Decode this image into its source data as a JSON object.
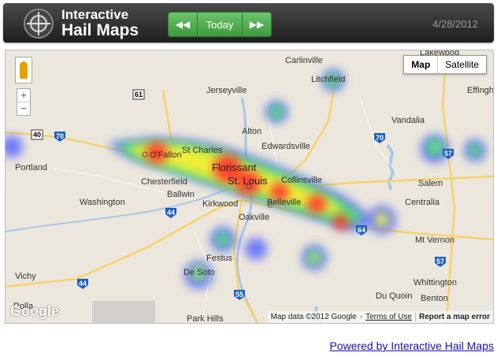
{
  "header": {
    "logo_line1": "Interactive",
    "logo_line2": "Hail Maps",
    "prev_icon": "double-left-arrow-icon",
    "next_icon": "double-right-arrow-icon",
    "today_label": "Today",
    "date": "4/28/2012"
  },
  "map": {
    "type_options": [
      "Map",
      "Satellite"
    ],
    "active_type": "Map",
    "zoom_in": "+",
    "zoom_out": "−",
    "google_logo": "Google",
    "attribution": "Map data ©2012 Google",
    "terms": "Terms of Use",
    "report": "Report a map error",
    "places": [
      "Carlinville",
      "Lakewood",
      "Litchfield",
      "Effingham",
      "Jerseyville",
      "Alton",
      "Vandalia",
      "Edwardsville",
      "O'Fallon",
      "St Charles",
      "Florissant",
      "Chesterfield",
      "St. Louis",
      "Collinsville",
      "Salem",
      "Ballwin",
      "Kirkwood",
      "Belleville",
      "Centralia",
      "Washington",
      "Portland",
      "Oakville",
      "Festus",
      "Mt Vernon",
      "De Soto",
      "Vichy",
      "Whittington",
      "Rolla",
      "Du Quoin",
      "Benton",
      "Park Hills"
    ],
    "route_shields": [
      "61",
      "40",
      "70",
      "70",
      "57",
      "44",
      "44",
      "55",
      "64",
      "57"
    ]
  },
  "footer": {
    "link": "Powered by Interactive Hail Maps"
  },
  "colors": {
    "header_bg": "#2a2a2a",
    "nav_green": "#4fae4f",
    "link_blue": "#1a0dab",
    "map_bg": "#ece7dc",
    "heat_red": "#ff3b2f",
    "heat_yellow": "#ffee33",
    "heat_green": "#55ee66",
    "heat_blue": "#5566ff"
  }
}
